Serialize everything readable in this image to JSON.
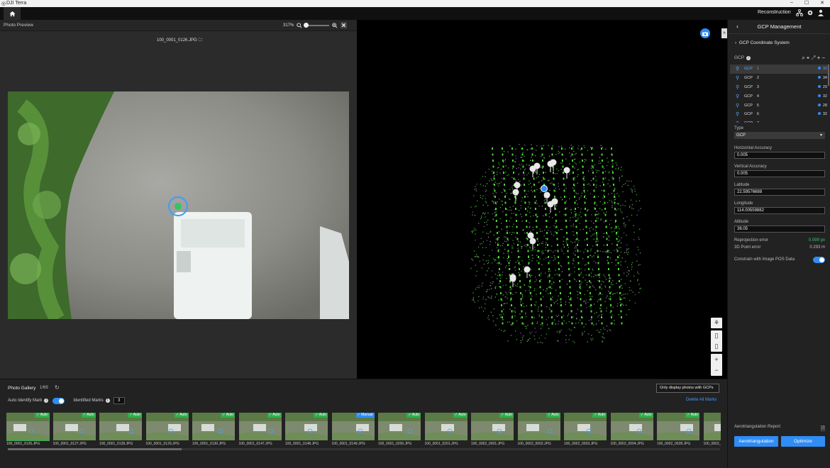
{
  "app": {
    "title": "DJI Terra",
    "minimize": "‒",
    "maximize": "☐",
    "close": "✕"
  },
  "topbar": {
    "mode": "Reconstruction"
  },
  "photo_preview": {
    "title": "Photo Preview",
    "zoom": "317%",
    "file_name": "100_0001_0126.JPG"
  },
  "gcp_panel": {
    "title": "GCP Management",
    "coord_system": "GCP Coordinate System",
    "list_label": "GCP",
    "items": [
      {
        "name": "GCP",
        "id": "1",
        "count": "32",
        "selected": true
      },
      {
        "name": "GCP",
        "id": "2",
        "count": "34"
      },
      {
        "name": "GCP",
        "id": "3",
        "count": "29"
      },
      {
        "name": "GCP",
        "id": "4",
        "count": "32"
      },
      {
        "name": "GCP",
        "id": "5",
        "count": "28"
      },
      {
        "name": "GCP",
        "id": "6",
        "count": "32"
      },
      {
        "name": "GCP",
        "id": "7",
        "count": ""
      }
    ],
    "type_label": "Type",
    "type_value": "GCP",
    "horizontal_accuracy_label": "Horizontal Accuracy",
    "horizontal_accuracy": "0.005",
    "vertical_accuracy_label": "Vertical Accuracy",
    "vertical_accuracy": "0.005",
    "latitude_label": "Latitude",
    "latitude": "22.59576688",
    "longitude_label": "Longitude",
    "longitude": "114.00559882",
    "altitude_label": "Altitude",
    "altitude": "38.05",
    "reprojection_error_label": "Reprojection error",
    "reprojection_error": "0.099 px",
    "point_error_label": "3D Point error",
    "point_error": "0.293 m",
    "constrain_label": "Constrain with Image POS Data",
    "report_label": "Aerotriangulation Report",
    "aerotriangulation_button": "Aerotriangulation",
    "optimize_button": "Optimize"
  },
  "gallery": {
    "title": "Photo Gallery",
    "count": "1/69",
    "auto_identify_label": "Auto Identify Mark",
    "identified_label": "Identified Marks",
    "identified_value": "3",
    "filter": "Only display photos with GCPs",
    "delete_all": "Delete All Marks",
    "thumbs": [
      {
        "name": "100_0001_0126.JPG",
        "badge": "✓ Auto"
      },
      {
        "name": "100_0001_0127.JPG",
        "badge": "✓ Auto"
      },
      {
        "name": "100_0001_0128.JPG",
        "badge": "✓ Auto"
      },
      {
        "name": "100_0001_0129.JPG",
        "badge": "✓ Auto"
      },
      {
        "name": "100_0001_0130.JPG",
        "badge": "✓ Auto"
      },
      {
        "name": "100_0001_0147.JPG",
        "badge": "✓ Auto"
      },
      {
        "name": "100_0001_0148.JPG",
        "badge": "✓ Auto"
      },
      {
        "name": "100_0001_0149.JPG",
        "badge": "✓ Manual"
      },
      {
        "name": "100_0001_0200.JPG",
        "badge": "✓ Auto"
      },
      {
        "name": "100_0001_0201.JPG",
        "badge": "✓ Auto"
      },
      {
        "name": "100_0002_0001.JPG",
        "badge": "✓ Auto"
      },
      {
        "name": "100_0002_0002.JPG",
        "badge": "✓ Auto"
      },
      {
        "name": "100_0002_0003.JPG",
        "badge": "✓ Auto"
      },
      {
        "name": "100_0002_0004.JPG",
        "badge": "✓ Auto"
      },
      {
        "name": "100_0002_0028.JPG",
        "badge": "✓ Auto"
      },
      {
        "name": "100_0002_",
        "badge": ""
      }
    ]
  },
  "colors": {
    "accent": "#2f8df5",
    "success": "#2db04a",
    "background": "#1b1b1b"
  }
}
